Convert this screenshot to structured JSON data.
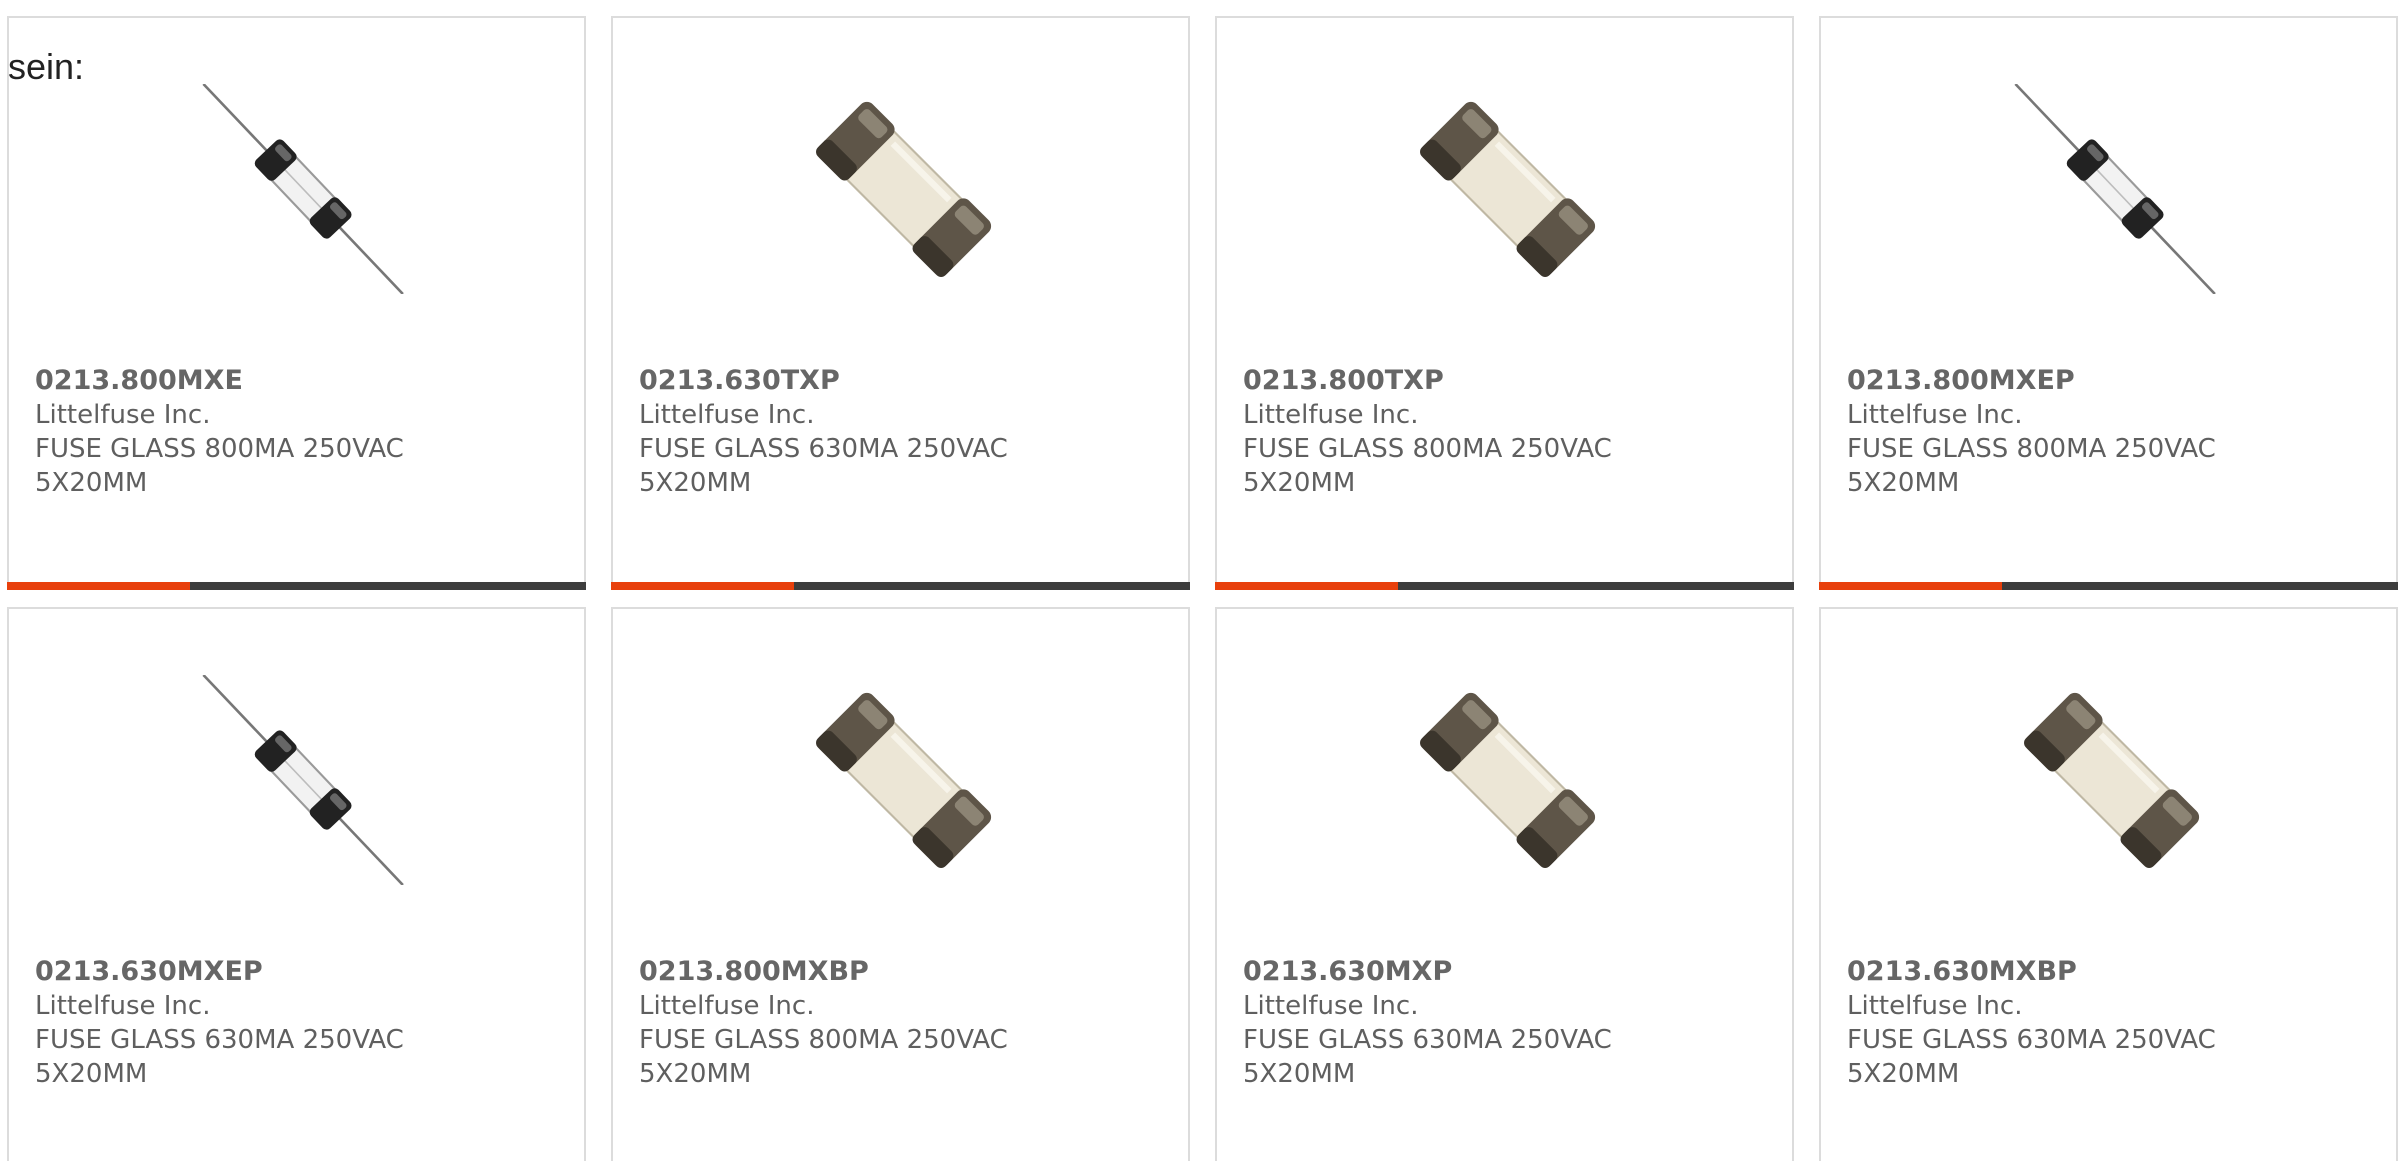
{
  "intro_text": "sein:",
  "accent_color": "#e8400c",
  "products": [
    {
      "part_number": "0213.800MXE",
      "manufacturer": "Littelfuse Inc.",
      "description": "FUSE GLASS 800MA 250VAC 5X20MM",
      "image_icon": "axial-fuse-icon",
      "accent_bar": true
    },
    {
      "part_number": "0213.630TXP",
      "manufacturer": "Littelfuse Inc.",
      "description": "FUSE GLASS 630MA 250VAC 5X20MM",
      "image_icon": "cartridge-fuse-icon",
      "accent_bar": true
    },
    {
      "part_number": "0213.800TXP",
      "manufacturer": "Littelfuse Inc.",
      "description": "FUSE GLASS 800MA 250VAC 5X20MM",
      "image_icon": "cartridge-fuse-icon",
      "accent_bar": true
    },
    {
      "part_number": "0213.800MXEP",
      "manufacturer": "Littelfuse Inc.",
      "description": "FUSE GLASS 800MA 250VAC 5X20MM",
      "image_icon": "axial-fuse-icon",
      "accent_bar": true
    },
    {
      "part_number": "0213.630MXEP",
      "manufacturer": "Littelfuse Inc.",
      "description": "FUSE GLASS 630MA 250VAC 5X20MM",
      "image_icon": "axial-fuse-icon",
      "accent_bar": false
    },
    {
      "part_number": "0213.800MXBP",
      "manufacturer": "Littelfuse Inc.",
      "description": "FUSE GLASS 800MA 250VAC 5X20MM",
      "image_icon": "cartridge-fuse-icon",
      "accent_bar": false
    },
    {
      "part_number": "0213.630MXP",
      "manufacturer": "Littelfuse Inc.",
      "description": "FUSE GLASS 630MA 250VAC 5X20MM",
      "image_icon": "cartridge-fuse-icon",
      "accent_bar": false
    },
    {
      "part_number": "0213.630MXBP",
      "manufacturer": "Littelfuse Inc.",
      "description": "FUSE GLASS 630MA 250VAC 5X20MM",
      "image_icon": "cartridge-fuse-icon",
      "accent_bar": false
    }
  ]
}
